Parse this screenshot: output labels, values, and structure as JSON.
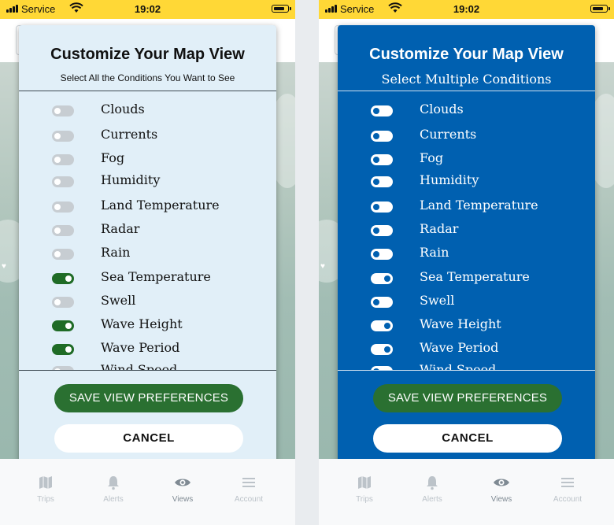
{
  "status_bar": {
    "carrier": "Service",
    "time": "19:02"
  },
  "modal": {
    "title": "Customize Your Map View",
    "subtitle_default": "Select All the Conditions You Want to See",
    "subtitle_alt": "Select Multiple Conditions",
    "save_label": "SAVE VIEW PREFERENCES",
    "cancel_label": "CANCEL"
  },
  "left_conditions": [
    {
      "label": "Clouds",
      "on": false
    },
    {
      "label": "Currents",
      "on": false
    },
    {
      "label": "Fog",
      "on": false
    },
    {
      "label": "Humidity",
      "on": false
    },
    {
      "label": "Land Temperature",
      "on": false
    },
    {
      "label": "Radar",
      "on": false
    },
    {
      "label": "Rain",
      "on": false
    },
    {
      "label": "Sea Temperature",
      "on": true
    },
    {
      "label": "Swell",
      "on": false
    },
    {
      "label": "Wave Height",
      "on": true
    },
    {
      "label": "Wave Period",
      "on": true
    },
    {
      "label": "Wind Speed",
      "on": false
    }
  ],
  "right_conditions": [
    {
      "label": "Clouds",
      "on": false
    },
    {
      "label": "Currents",
      "on": false
    },
    {
      "label": "Fog",
      "on": false
    },
    {
      "label": "Humidity",
      "on": false
    },
    {
      "label": "Land Temperature",
      "on": false
    },
    {
      "label": "Radar",
      "on": false
    },
    {
      "label": "Rain",
      "on": false
    },
    {
      "label": "Sea Temperature",
      "on": true
    },
    {
      "label": "Swell",
      "on": false
    },
    {
      "label": "Wave Height",
      "on": true
    },
    {
      "label": "Wave Period",
      "on": true
    },
    {
      "label": "Wind Speed",
      "on": false
    }
  ],
  "tabs": [
    {
      "label": "Trips",
      "icon": "map-icon",
      "active": false
    },
    {
      "label": "Alerts",
      "icon": "bell-icon",
      "active": false
    },
    {
      "label": "Views",
      "icon": "eye-icon",
      "active": true
    },
    {
      "label": "Account",
      "icon": "menu-icon",
      "active": false
    }
  ],
  "colors": {
    "status_bar": "#ffd836",
    "left_card": "#e1eff8",
    "right_card": "#0060b0",
    "toggle_on": "#1f6b26",
    "save_button": "#2a7031"
  }
}
